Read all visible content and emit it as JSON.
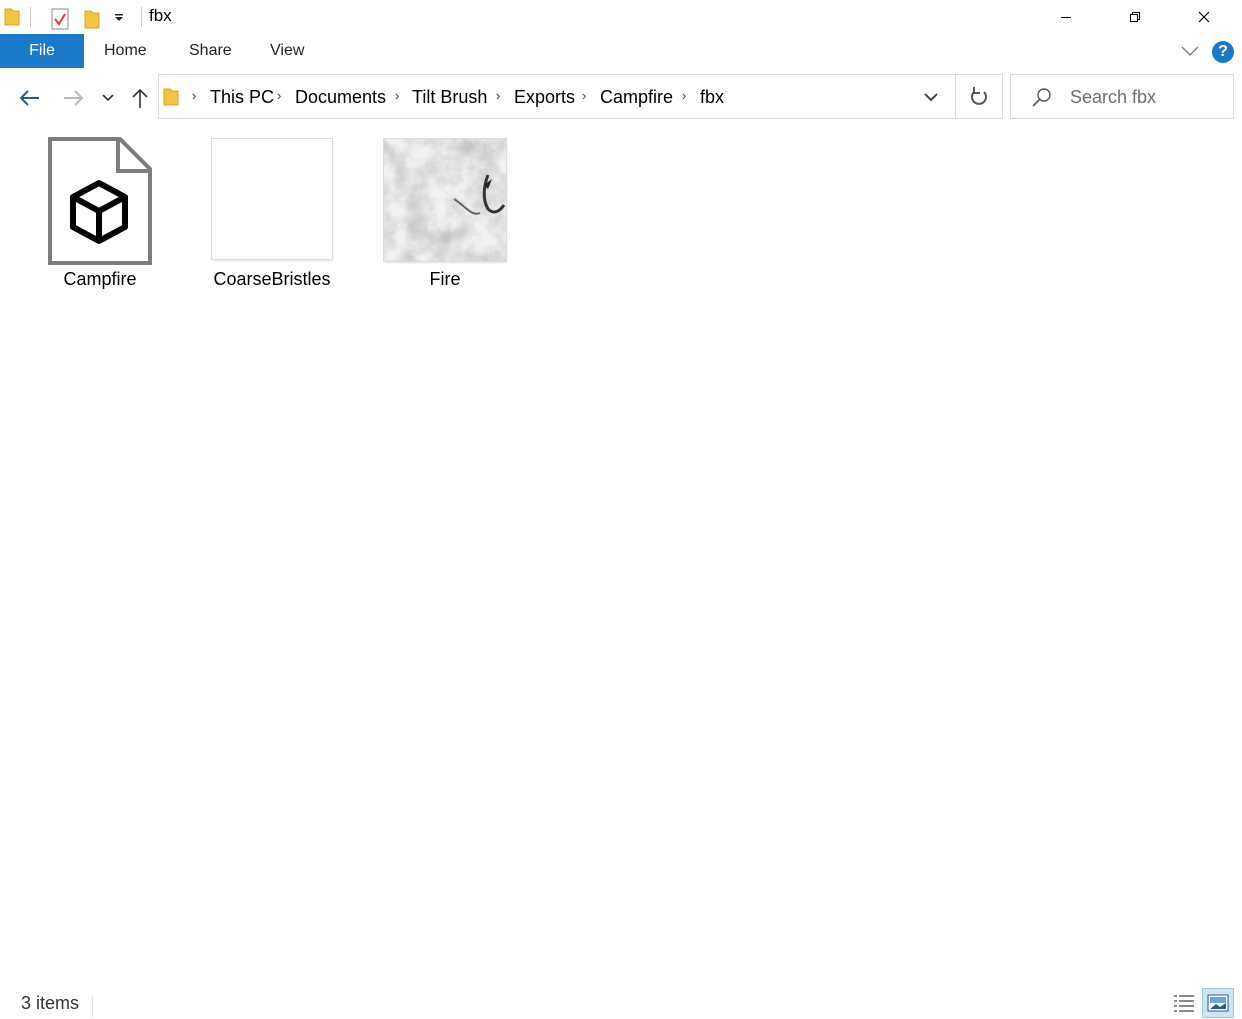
{
  "window": {
    "title": "fbx"
  },
  "ribbon": {
    "tabs": [
      {
        "label": "File",
        "active": true
      },
      {
        "label": "Home"
      },
      {
        "label": "Share"
      },
      {
        "label": "View"
      }
    ],
    "help_label": "?"
  },
  "address": {
    "breadcrumb": [
      "This PC",
      "Documents",
      "Tilt Brush",
      "Exports",
      "Campfire",
      "fbx"
    ]
  },
  "search": {
    "placeholder": "Search fbx"
  },
  "files": [
    {
      "name": "Campfire",
      "icon": "3d-object-file-icon"
    },
    {
      "name": "CoarseBristles",
      "icon": "blank-image-thumbnail"
    },
    {
      "name": "Fire",
      "icon": "smoke-texture-thumbnail"
    }
  ],
  "status": {
    "item_count": "3 items"
  },
  "colors": {
    "accent": "#1979ca",
    "border": "#d9d9d9"
  }
}
